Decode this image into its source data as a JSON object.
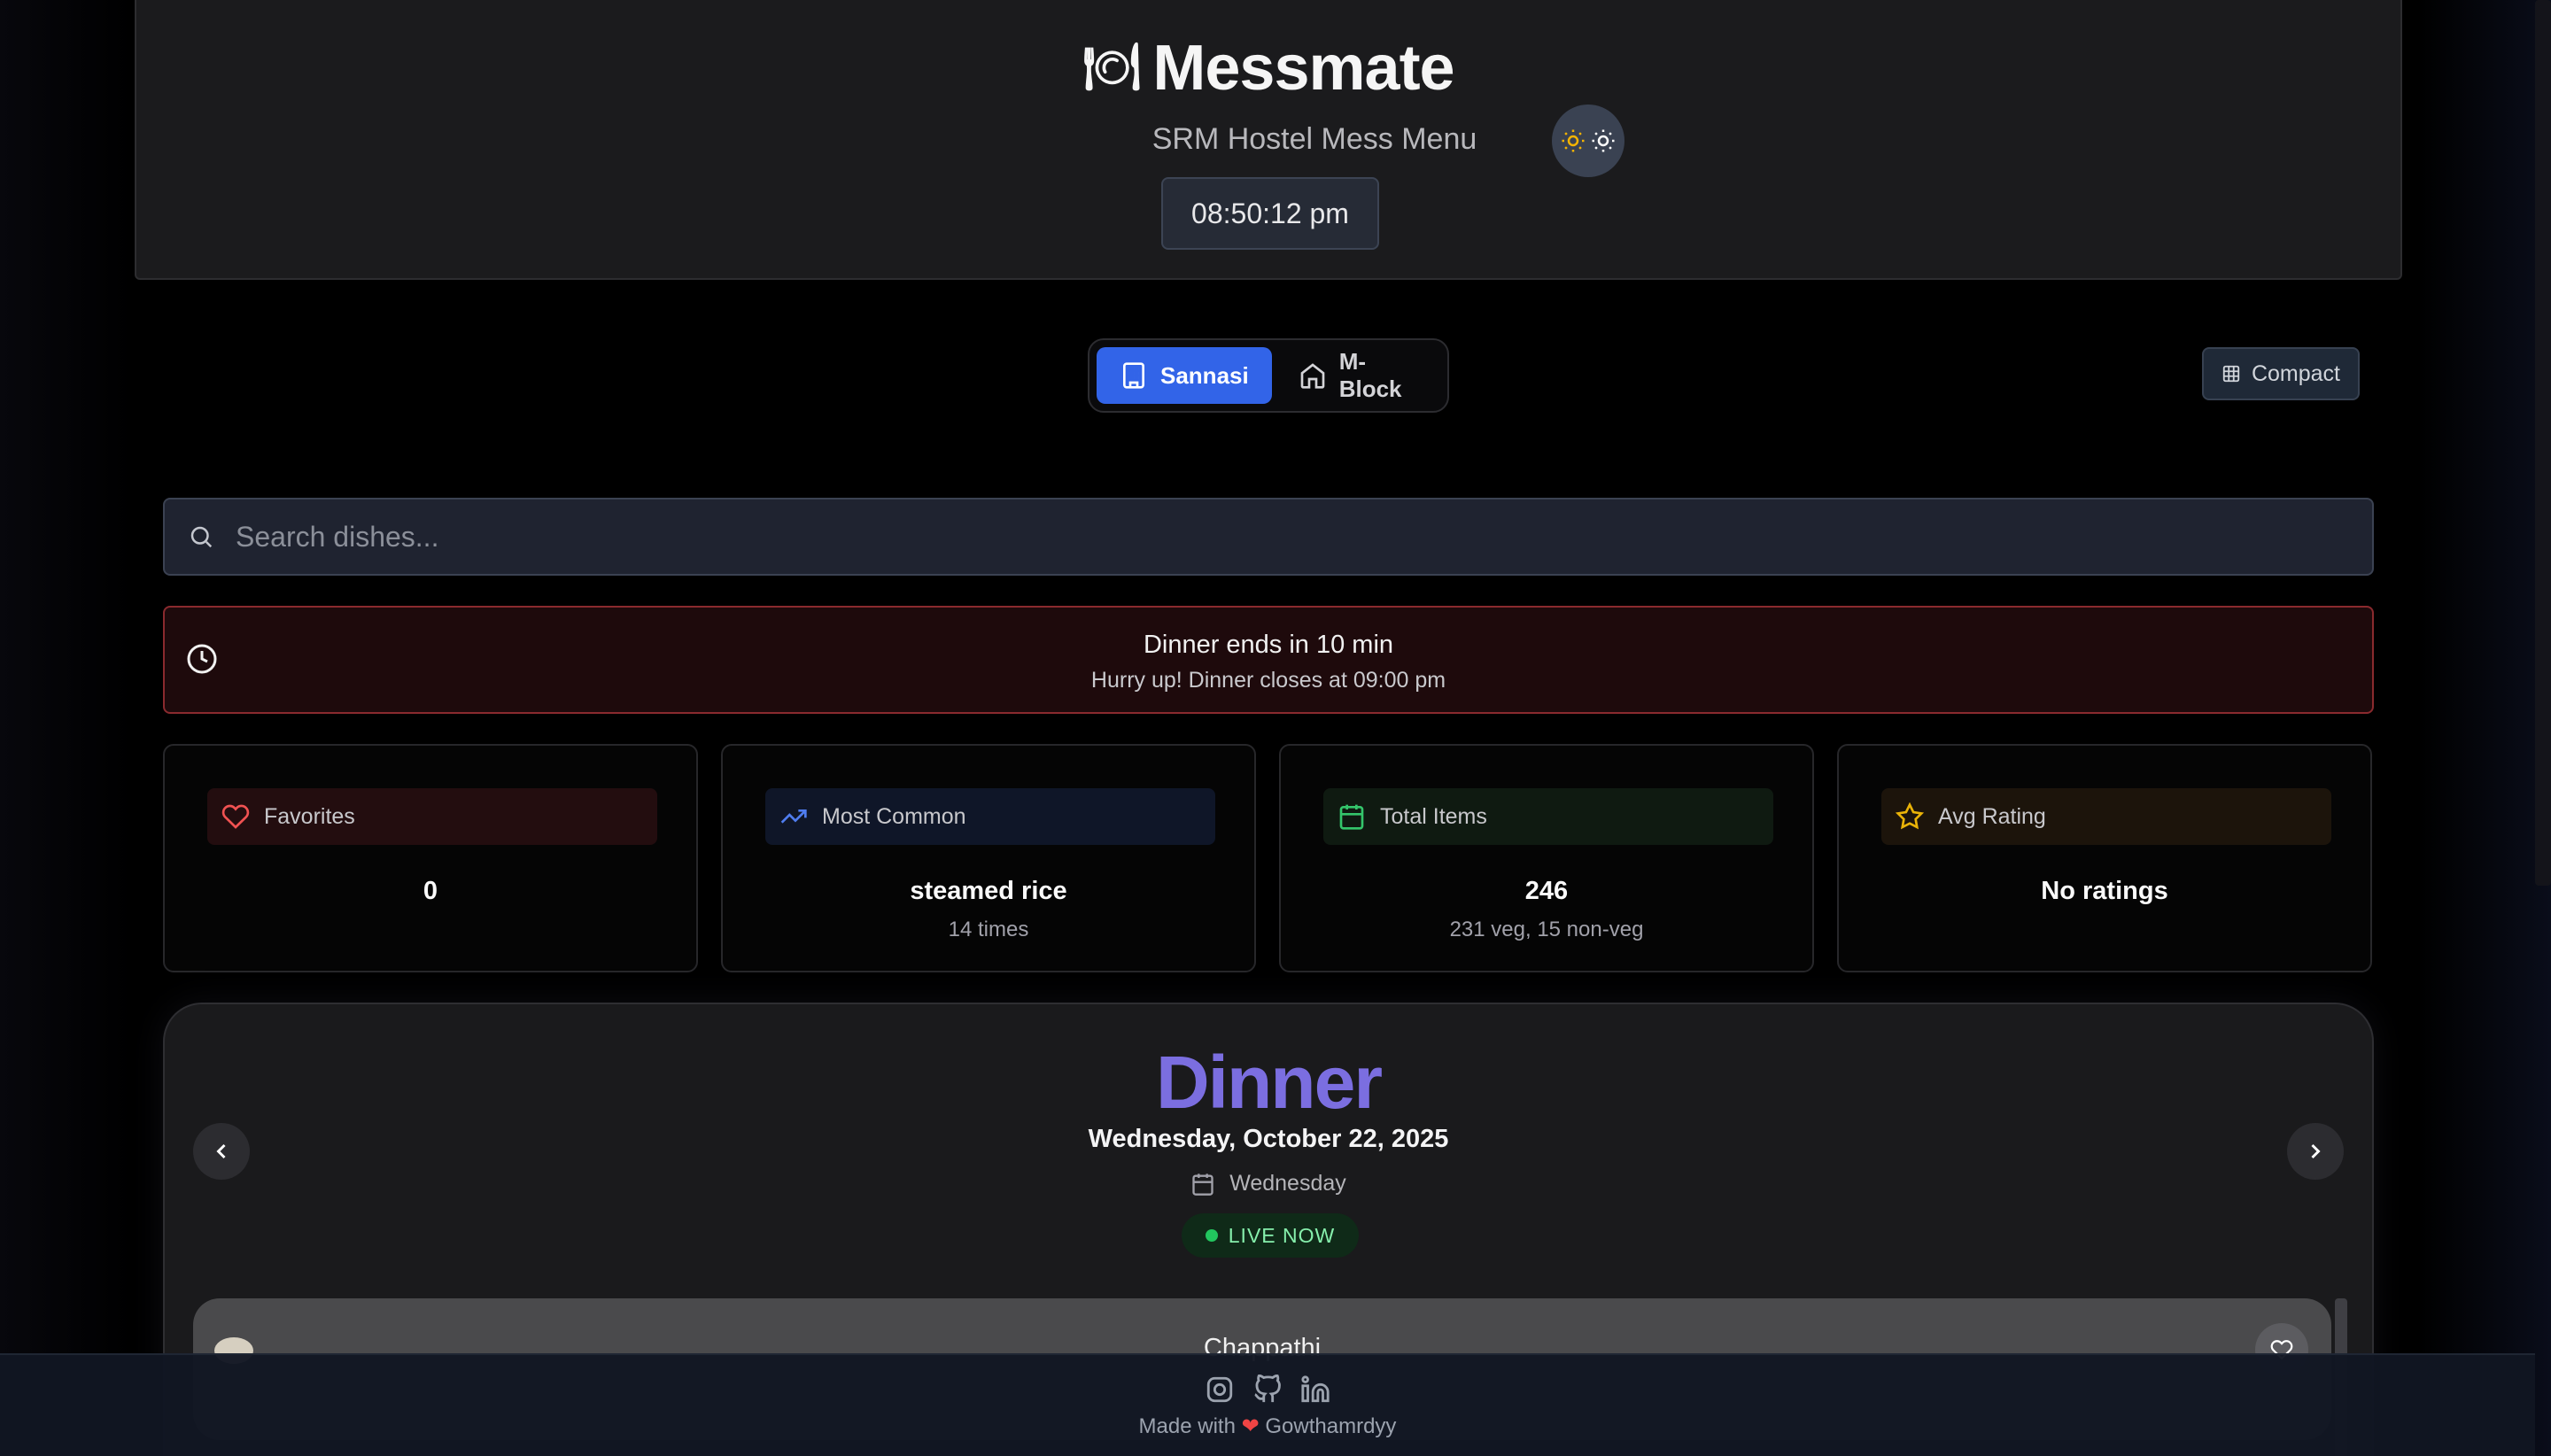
{
  "app": {
    "icon": "plate-icon",
    "title": "Messmate",
    "subtitle": "SRM Hostel Mess Menu",
    "clock": "08:50:12 pm",
    "theme_toggle_icon": "sun-icon"
  },
  "hostels": {
    "items": [
      {
        "label": "Sannasi",
        "icon": "building-icon",
        "active": true
      },
      {
        "label": "M-Block",
        "icon": "home-icon",
        "active": false
      }
    ],
    "view_toggle_label": "Compact"
  },
  "search": {
    "placeholder": "Search dishes..."
  },
  "alert": {
    "title": "Dinner ends in 10 min",
    "subtitle": "Hurry up! Dinner closes at 09:00 pm"
  },
  "stats": [
    {
      "label": "Favorites",
      "icon": "heart-icon",
      "value": "0",
      "sub": ""
    },
    {
      "label": "Most Common",
      "icon": "trending-up-icon",
      "value": "steamed rice",
      "sub": "14 times"
    },
    {
      "label": "Total Items",
      "icon": "calendar-icon",
      "value": "246",
      "sub": "231 veg, 15 non-veg"
    },
    {
      "label": "Avg Rating",
      "icon": "star-icon",
      "value": "No ratings",
      "sub": ""
    }
  ],
  "meal": {
    "title": "Dinner",
    "date": "Wednesday, October 22, 2025",
    "day": "Wednesday",
    "status": "LIVE NOW",
    "dishes": [
      {
        "name": "Chappathi"
      }
    ]
  },
  "footer": {
    "made_with": "Made with",
    "author": "Gowthamrdyy",
    "links": [
      "instagram-icon",
      "github-icon",
      "linkedin-icon"
    ]
  },
  "colors": {
    "accent": "#3264e8",
    "meal_title": "#7b6ee0",
    "live": "#22c55e",
    "alert_border": "#8a2a2e"
  }
}
